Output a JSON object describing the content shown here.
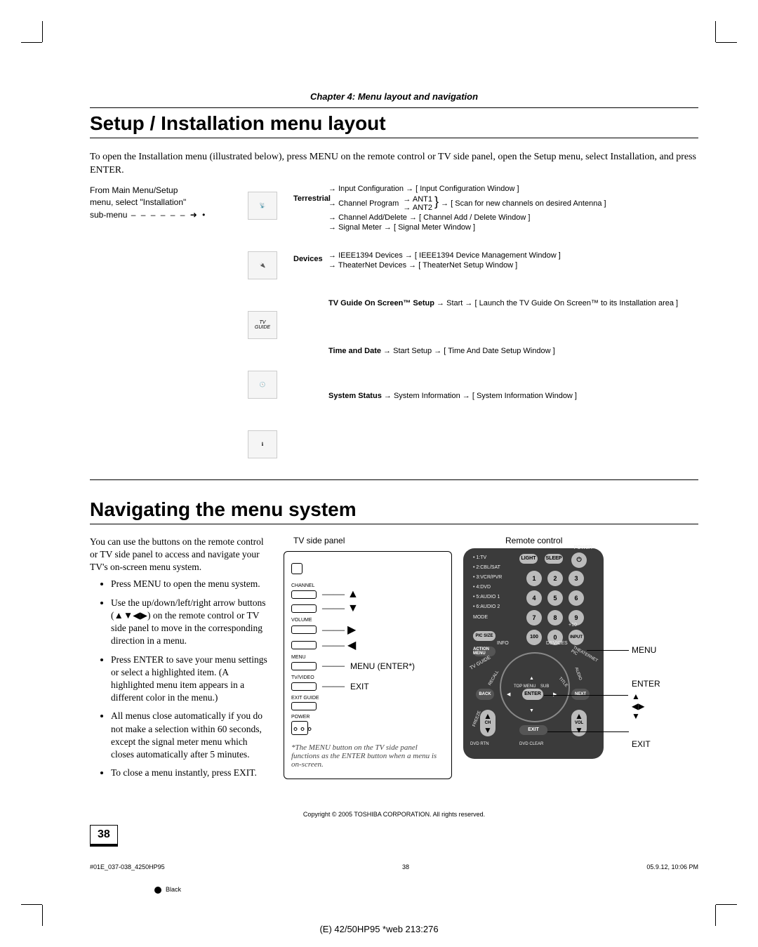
{
  "chapter": {
    "title": "Chapter 4: Menu layout and navigation"
  },
  "setup": {
    "heading": "Setup / Installation menu layout",
    "intro": "To open the Installation menu (illustrated below), press MENU on the remote control or TV side panel, open the Setup menu, select Installation, and press ENTER.",
    "diagram": {
      "caption_l1": "From Main Menu/Setup",
      "caption_l2": "menu, select \"Installation\"",
      "caption_l3": "sub-menu",
      "terrestrial": {
        "label": "Terrestrial",
        "input_config": "Input Configuration",
        "input_config_win": "[ Input Configuration Window ]",
        "channel_program": "Channel Program",
        "ant1": "ANT1",
        "ant2": "ANT2",
        "scan": "[ Scan for new channels on desired Antenna ]",
        "add_delete": "Channel Add/Delete",
        "add_delete_win": "[ Channel Add / Delete Window ]",
        "signal_meter": "Signal Meter",
        "signal_meter_win": "[ Signal Meter Window ]"
      },
      "devices": {
        "label": "Devices",
        "ieee": "IEEE1394 Devices",
        "ieee_win": "[ IEEE1394 Device Management Window ]",
        "theater": "TheaterNet Devices",
        "theater_win": "[ TheaterNet Setup Window ]"
      },
      "tvguide": {
        "label": "TV Guide On Screen™ Setup",
        "start": "Start",
        "win": "[ Launch the TV Guide On Screen™ to its Installation area ]"
      },
      "timedate": {
        "label": "Time and Date",
        "start": "Start Setup",
        "win": "[ Time And Date Setup Window ]"
      },
      "systemstatus": {
        "label": "System Status",
        "info": "System Information",
        "win": "[ System Information Window ]"
      }
    }
  },
  "nav": {
    "heading": "Navigating the menu system",
    "intro": "You can use the buttons on the remote control or TV side panel to access and navigate your TV's on-screen menu system.",
    "bullets": [
      "Press MENU to open the menu system.",
      "Use the up/down/left/right arrow buttons (▲▼◀▶) on the remote control or TV side panel to move in the corresponding direction in a menu.",
      "Press ENTER to save your menu settings or select a highlighted item. (A highlighted menu item appears in a different color in the menu.)",
      "All menus close automatically if you do not make a selection within 60 seconds, except the signal meter menu which closes automatically after 5 minutes.",
      "To close a menu instantly, press EXIT."
    ],
    "tvpanel": {
      "caption": "TV side panel",
      "labels": {
        "channel": "CHANNEL",
        "volume": "VOLUME",
        "menu": "MENU",
        "tvvideo": "TV/VIDEO",
        "exitguide": "EXIT GUIDE",
        "power": "POWER"
      },
      "menu_enter": "MENU (ENTER*)",
      "exit": "EXIT",
      "note": "*The MENU button on the TV side panel functions as the ENTER button when a menu is on-screen."
    },
    "remote": {
      "caption": "Remote control",
      "modes": [
        "1:TV",
        "2:CBL/SAT",
        "3:VCR/PVR",
        "4:DVD",
        "5:AUDIO 1",
        "6:AUDIO 2"
      ],
      "mode": "MODE",
      "btns": {
        "light": "LIGHT",
        "sleep": "SLEEP",
        "power": "POWER",
        "input": "INPUT",
        "plus10": "+10",
        "picsize": "PIC SIZE",
        "actionmenu": "ACTION MENU",
        "info": "INFO",
        "devices": "DEVICES",
        "tvguide": "TV GUIDE",
        "recall": "RECALL",
        "topmenu": "TOP MENU",
        "sub": "SUB",
        "title": "TITLE",
        "audio": "AUDIO",
        "theaternet": "THEATERNET PIC",
        "enter": "ENTER",
        "back": "BACK",
        "next": "NEXT",
        "ch": "CH",
        "vol": "VOL",
        "exit": "EXIT",
        "freeze": "FREEZE",
        "dvdrtn": "DVD RTN",
        "dvdclear": "DVD CLEAR"
      },
      "annot": {
        "menu": "MENU",
        "enter": "ENTER",
        "exit": "EXIT"
      }
    }
  },
  "footer": {
    "copyright": "Copyright © 2005 TOSHIBA CORPORATION. All rights reserved.",
    "page_number": "38",
    "file_id": "#01E_037-038_4250HP95",
    "page_small": "38",
    "timestamp": "05.9.12, 10:06 PM",
    "black": "Black",
    "bottom": "(E) 42/50HP95 *web 213:276"
  }
}
